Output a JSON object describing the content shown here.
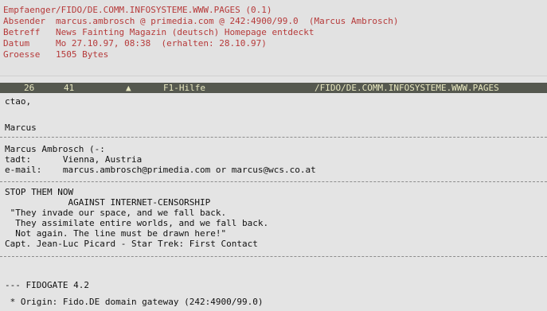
{
  "header": {
    "rows": [
      {
        "key": "Empfaenger",
        "value": "/FIDO/DE.COMM.INFOSYSTEME.WWW.PAGES (0.1)"
      },
      {
        "key": "Absender",
        "value": "marcus.ambrosch @ primedia.com @ 242:4900/99.0  (Marcus Ambrosch)"
      },
      {
        "key": "Betreff",
        "value": "News Fainting Magazin (deutsch) Homepage entdeckt"
      },
      {
        "key": "Datum",
        "value": "Mo 27.10.97, 08:38  (erhalten: 28.10.97)"
      },
      {
        "key": "Groesse",
        "value": "1505 Bytes"
      }
    ]
  },
  "statusbar": {
    "num1": "26",
    "num2": "41",
    "arrow": "▲",
    "file": "F1-Hilfe",
    "path": "/FIDO/DE.COMM.INFOSYSTEME.WWW.PAGES"
  },
  "message": {
    "lines": [
      "ctao,",
      "",
      "Marcus",
      "Marcus Ambrosch (-:",
      "tadt:      Vienna, Austria",
      "e-mail:    marcus.ambrosch@primedia.com or marcus@wcs.co.at",
      "STOP THEM NOW",
      "            AGAINST INTERNET-CENSORSHIP",
      " \"They invade our space, and we fall back.",
      "  They assimilate entire worlds, and we fall back.",
      "  Not again. The line must be drawn here!\"",
      "Capt. Jean-Luc Picard - Star Trek: First Contact",
      "--- FIDOGATE 4.2",
      " * Origin: Fido.DE domain gateway (242:4900/99.0)"
    ]
  }
}
